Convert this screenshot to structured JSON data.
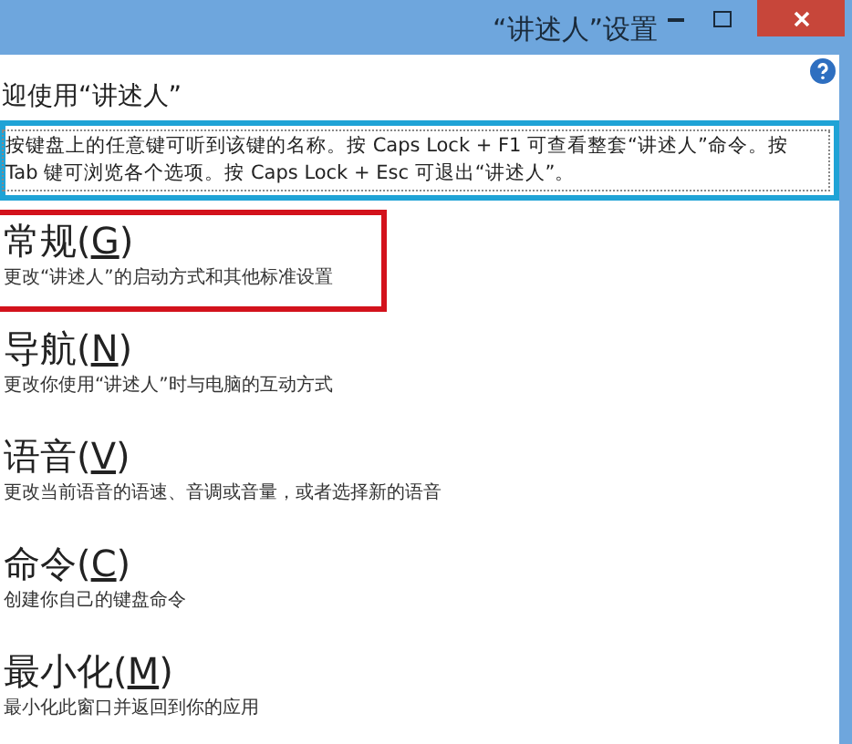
{
  "window": {
    "title": "“讲述人”设置"
  },
  "intro": {
    "heading": "迎使用“讲述人”",
    "text": "按键盘上的任意键可听到该键的名称。按 Caps Lock + F1 可查看整套“讲述人”命令。按 Tab 键可浏览各个选项。按 Caps Lock + Esc 可退出“讲述人”。",
    "highlighted": true
  },
  "items": [
    {
      "prefix": "常规(",
      "key": "G",
      "suffix": ")",
      "description": "更改“讲述人”的启动方式和其他标准设置",
      "highlighted": true
    },
    {
      "prefix": "导航(",
      "key": "N",
      "suffix": ")",
      "description": "更改你使用“讲述人”时与电脑的互动方式",
      "highlighted": false
    },
    {
      "prefix": "语音(",
      "key": "V",
      "suffix": ")",
      "description": "更改当前语音的语速、音调或音量，或者选择新的语音",
      "highlighted": false
    },
    {
      "prefix": "命令(",
      "key": "C",
      "suffix": ")",
      "description": "创建你自己的键盘命令",
      "highlighted": false
    },
    {
      "prefix": "最小化(",
      "key": "M",
      "suffix": ")",
      "description": "最小化此窗口并返回到你的应用",
      "highlighted": false
    }
  ]
}
